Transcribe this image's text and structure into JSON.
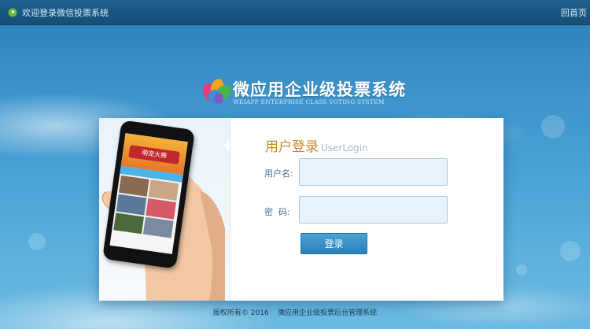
{
  "topbar": {
    "welcome_text": "欢迎登录微信投票系统",
    "home_link": "回首页"
  },
  "logo": {
    "title": "微应用企业级投票系统",
    "subtitle": "WEIAPP ENTERPRISE CLASS VOTING SYSTEM"
  },
  "login": {
    "title_cn": "用户登录",
    "title_en": "UserLogin",
    "username_label": "用户名:",
    "username_value": "",
    "password_label": "密  码:",
    "password_value": "",
    "submit_label": "登录"
  },
  "phone_screen": {
    "banner_text": "萌宠大赛"
  },
  "footer": {
    "copyright": "版权所有© 2016",
    "system_name": "微应用企业级投票后台管理系统"
  },
  "colors": {
    "accent": "#2c7fb9",
    "title_orange": "#c98b2c",
    "topbar": "#1c5f8e"
  },
  "icons": {
    "topbar": "play-icon",
    "logo": "colorful-petal-logo-icon"
  }
}
